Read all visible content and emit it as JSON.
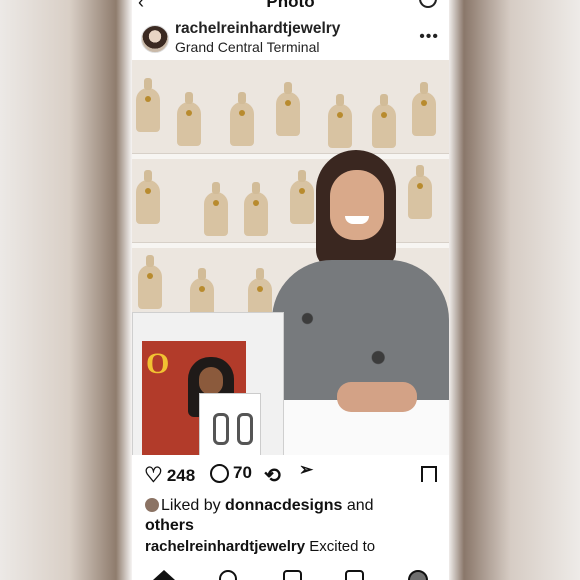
{
  "header": {
    "title": "Photo"
  },
  "post": {
    "username": "rachelreinhardtjewelry",
    "location": "Grand Central Terminal",
    "more_label": "•••"
  },
  "magazine": {
    "logo": "O"
  },
  "actions": {
    "likes_count": "248",
    "comments_count": "70"
  },
  "likes": {
    "prefix": "Liked by ",
    "user": "donnacdesigns",
    "middle": " and",
    "others": "others"
  },
  "caption": {
    "user": "rachelreinhardtjewelry",
    "text": " Excited to"
  },
  "icons": [
    "back-icon",
    "refresh-icon",
    "more-icon",
    "heart-icon",
    "comment-icon",
    "repost-icon",
    "share-icon",
    "bookmark-icon",
    "home-icon",
    "search-icon",
    "create-icon",
    "reels-icon",
    "profile-icon"
  ]
}
